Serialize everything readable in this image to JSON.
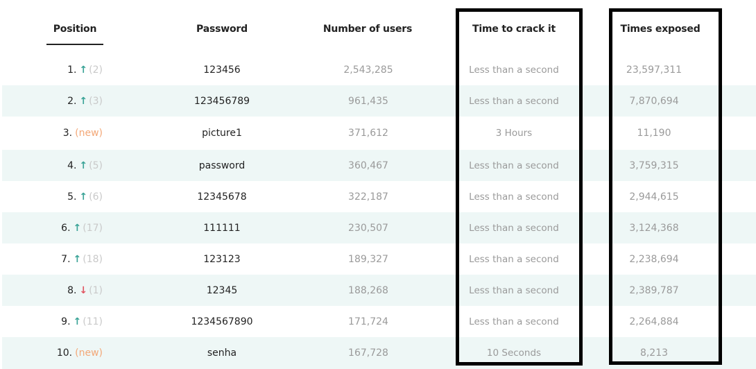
{
  "table": {
    "headers": {
      "position": "Position",
      "password": "Password",
      "users": "Number of users",
      "crack": "Time to crack it",
      "exposed": "Times exposed"
    },
    "rows": [
      {
        "position": "1.",
        "trend": "up",
        "trend_icon": "↑",
        "previous": "(2)",
        "password": "123456",
        "users": "2,543,285",
        "crack": "Less than a second",
        "exposed": "23,597,311"
      },
      {
        "position": "2.",
        "trend": "up",
        "trend_icon": "↑",
        "previous": "(3)",
        "password": "123456789",
        "users": "961,435",
        "crack": "Less than a second",
        "exposed": "7,870,694"
      },
      {
        "position": "3.",
        "trend": "new",
        "trend_icon": "",
        "previous": "(new)",
        "password": "picture1",
        "users": "371,612",
        "crack": "3 Hours",
        "exposed": "11,190"
      },
      {
        "position": "4.",
        "trend": "up",
        "trend_icon": "↑",
        "previous": "(5)",
        "password": "password",
        "users": "360,467",
        "crack": "Less than a second",
        "exposed": "3,759,315"
      },
      {
        "position": "5.",
        "trend": "up",
        "trend_icon": "↑",
        "previous": "(6)",
        "password": "12345678",
        "users": "322,187",
        "crack": "Less than a second",
        "exposed": "2,944,615"
      },
      {
        "position": "6.",
        "trend": "up",
        "trend_icon": "↑",
        "previous": "(17)",
        "password": "111111",
        "users": "230,507",
        "crack": "Less than a second",
        "exposed": "3,124,368"
      },
      {
        "position": "7.",
        "trend": "up",
        "trend_icon": "↑",
        "previous": "(18)",
        "password": "123123",
        "users": "189,327",
        "crack": "Less than a second",
        "exposed": "2,238,694"
      },
      {
        "position": "8.",
        "trend": "down",
        "trend_icon": "↓",
        "previous": "(1)",
        "password": "12345",
        "users": "188,268",
        "crack": "Less than a second",
        "exposed": "2,389,787"
      },
      {
        "position": "9.",
        "trend": "up",
        "trend_icon": "↑",
        "previous": "(11)",
        "password": "1234567890",
        "users": "171,724",
        "crack": "Less than a second",
        "exposed": "2,264,884"
      },
      {
        "position": "10.",
        "trend": "new",
        "trend_icon": "",
        "previous": "(new)",
        "password": "senha",
        "users": "167,728",
        "crack": "10 Seconds",
        "exposed": "8,213"
      }
    ]
  },
  "colors": {
    "up": "#3aa397",
    "down": "#e05561",
    "new": "#f3a878",
    "stripe": "#eef7f6"
  }
}
